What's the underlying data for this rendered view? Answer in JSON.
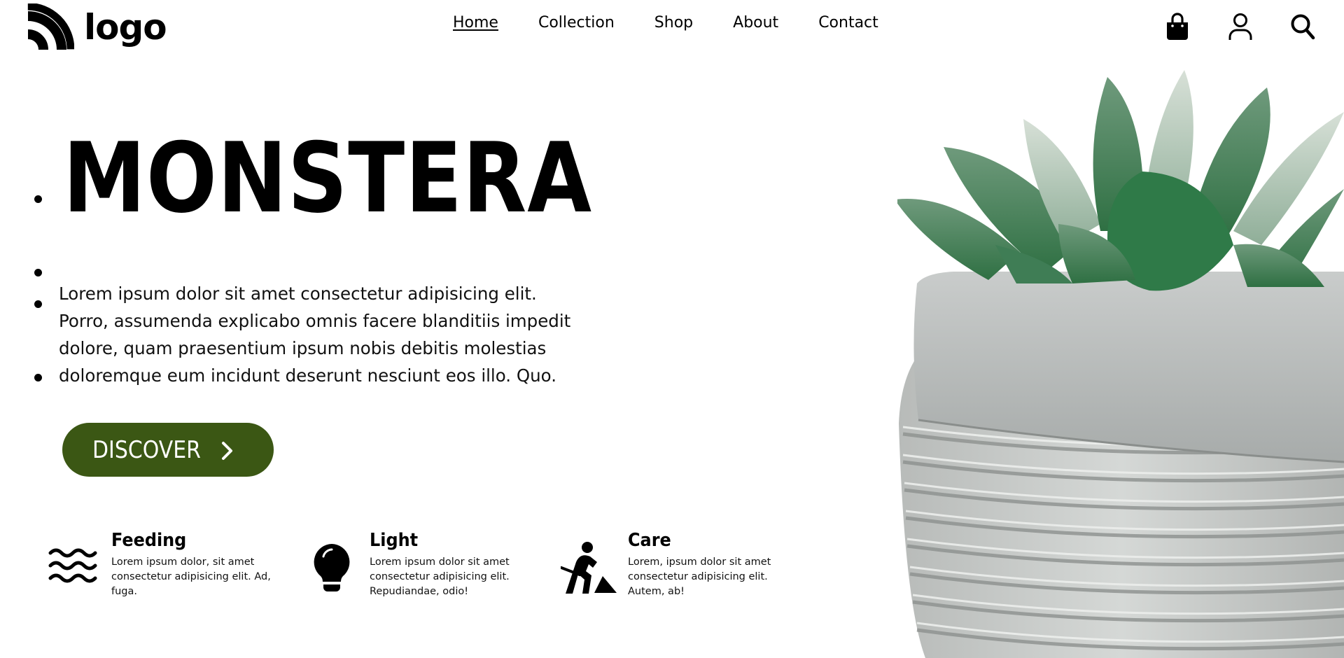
{
  "header": {
    "logo_text": "logo",
    "nav": [
      {
        "label": "Home",
        "active": true
      },
      {
        "label": "Collection",
        "active": false
      },
      {
        "label": "Shop",
        "active": false
      },
      {
        "label": "About",
        "active": false
      },
      {
        "label": "Contact",
        "active": false
      }
    ],
    "icons": [
      "shopping-bag-icon",
      "user-icon",
      "search-icon"
    ]
  },
  "hero": {
    "title": "MONSTERA",
    "description": "Lorem ipsum dolor sit amet consectetur adipisicing elit. Porro, assumenda explicabo omnis facere blanditiis impedit dolore, quam praesentium ipsum nobis debitis molestias doloremque eum incidunt deserunt nesciunt eos illo. Quo.",
    "cta_label": "DISCOVER",
    "cta_icon": "chevron-right-icon"
  },
  "features": [
    {
      "title": "Feeding",
      "text": "Lorem ipsum dolor, sit amet consectetur adipisicing elit. Ad, fuga.",
      "icon": "water-waves-icon"
    },
    {
      "title": "Light",
      "text": "Lorem ipsum dolor sit amet consectetur adipisicing elit. Repudiandae, odio!",
      "icon": "lightbulb-icon"
    },
    {
      "title": "Care",
      "text": "Lorem, ipsum dolor sit amet consectetur adipisicing elit. Autem, ab!",
      "icon": "person-digging-icon"
    }
  ],
  "colors": {
    "accent": "#3b5714",
    "text": "#000000",
    "background": "#ffffff"
  }
}
